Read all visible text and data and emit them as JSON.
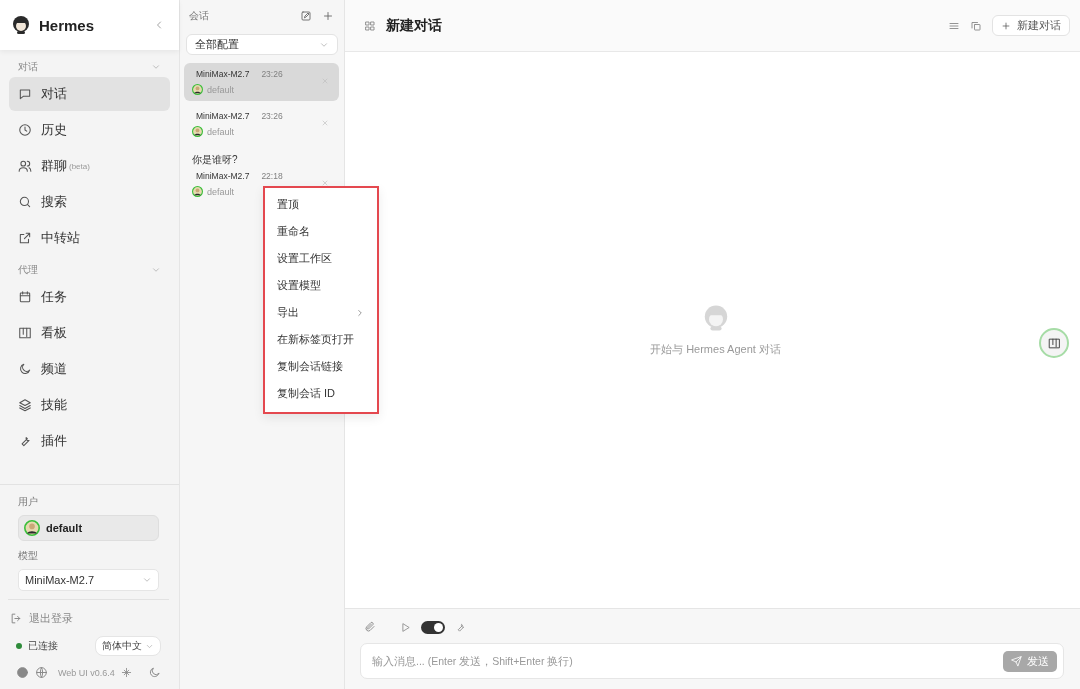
{
  "sidebar": {
    "brand": "Hermes",
    "sections": [
      {
        "title": "对话",
        "expanded": true,
        "items": [
          {
            "label": "对话",
            "selected": true
          },
          {
            "label": "历史",
            "selected": false
          },
          {
            "label": "群聊",
            "note": "(beta)",
            "selected": false
          },
          {
            "label": "搜索",
            "selected": false
          },
          {
            "label": "中转站",
            "selected": false
          }
        ]
      },
      {
        "title": "代理",
        "expanded": true,
        "items": [
          {
            "label": "任务",
            "selected": false
          },
          {
            "label": "看板",
            "selected": false
          },
          {
            "label": "频道",
            "selected": false
          },
          {
            "label": "技能",
            "selected": false
          },
          {
            "label": "插件",
            "selected": false
          }
        ]
      }
    ],
    "user": {
      "label": "用户",
      "name": "default"
    },
    "model": {
      "label": "模型",
      "value": "MiniMax-M2.7"
    },
    "logout": "退出登录",
    "status": {
      "connected": true,
      "label": "已连接"
    },
    "language": "简体中文",
    "version": "Web UI v0.6.4"
  },
  "sessions": {
    "title": "会话",
    "filter": "全部配置",
    "items": [
      {
        "model": "MiniMax-M2.7",
        "time": "23:26",
        "profile": "default",
        "selected": true
      },
      {
        "model": "MiniMax-M2.7",
        "time": "23:26",
        "profile": "default",
        "selected": false
      },
      {
        "title": "你是谁呀?",
        "model": "MiniMax-M2.7",
        "time": "22:18",
        "profile": "default",
        "selected": false
      }
    ]
  },
  "context_menu": {
    "items": [
      {
        "label": "置顶",
        "submenu": false
      },
      {
        "label": "重命名",
        "submenu": false
      },
      {
        "label": "设置工作区",
        "submenu": false
      },
      {
        "label": "设置模型",
        "submenu": false
      },
      {
        "label": "导出",
        "submenu": true
      },
      {
        "label": "在新标签页打开",
        "submenu": false
      },
      {
        "label": "复制会话链接",
        "submenu": false
      },
      {
        "label": "复制会话 ID",
        "submenu": false
      }
    ]
  },
  "main": {
    "title": "新建对话",
    "new_button": "新建对话",
    "empty_text": "开始与 Hermes Agent 对话",
    "composer": {
      "stream_on": true,
      "placeholder": "输入消息... (Enter 发送，Shift+Enter 换行)",
      "send": "发送"
    }
  }
}
